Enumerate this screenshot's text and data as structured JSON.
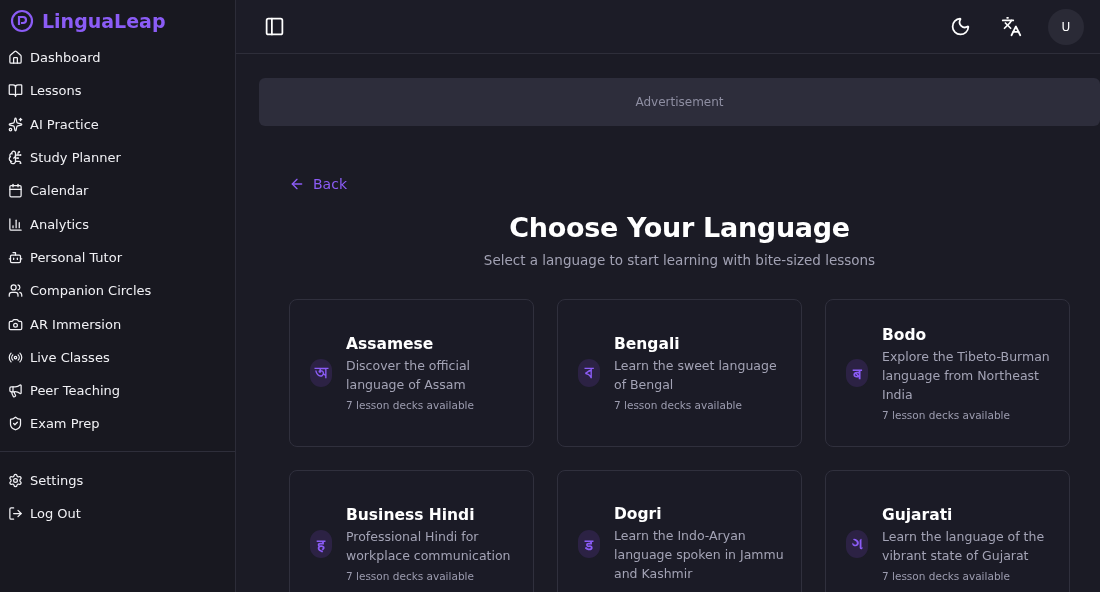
{
  "brand": "LinguaLeap",
  "sidebar": {
    "items": [
      {
        "label": "Dashboard"
      },
      {
        "label": "Lessons"
      },
      {
        "label": "AI Practice"
      },
      {
        "label": "Study Planner"
      },
      {
        "label": "Calendar"
      },
      {
        "label": "Analytics"
      },
      {
        "label": "Personal Tutor"
      },
      {
        "label": "Companion Circles"
      },
      {
        "label": "AR Immersion"
      },
      {
        "label": "Live Classes"
      },
      {
        "label": "Peer Teaching"
      },
      {
        "label": "Exam Prep"
      }
    ],
    "footer_items": [
      {
        "label": "Settings"
      },
      {
        "label": "Log Out"
      }
    ]
  },
  "header": {
    "avatar": "U"
  },
  "ad": "Advertisement",
  "back": "Back",
  "title": "Choose Your Language",
  "subtitle": "Select a language to start learning with bite-sized lessons",
  "languages": [
    {
      "script": "অ",
      "name": "Assamese",
      "description": "Discover the official language of Assam",
      "decks": "7 lesson decks available"
    },
    {
      "script": "ব",
      "name": "Bengali",
      "description": "Learn the sweet language of Bengal",
      "decks": "7 lesson decks available"
    },
    {
      "script": "ब",
      "name": "Bodo",
      "description": "Explore the Tibeto-Burman language from Northeast India",
      "decks": "7 lesson decks available"
    },
    {
      "script": "ह",
      "name": "Business Hindi",
      "description": "Professional Hindi for workplace communication",
      "decks": "7 lesson decks available"
    },
    {
      "script": "ड",
      "name": "Dogri",
      "description": "Learn the Indo-Aryan language spoken in Jammu and Kashmir"
    },
    {
      "script": "ગ",
      "name": "Gujarati",
      "description": "Learn the language of the vibrant state of Gujarat",
      "decks": "7 lesson decks available"
    }
  ]
}
